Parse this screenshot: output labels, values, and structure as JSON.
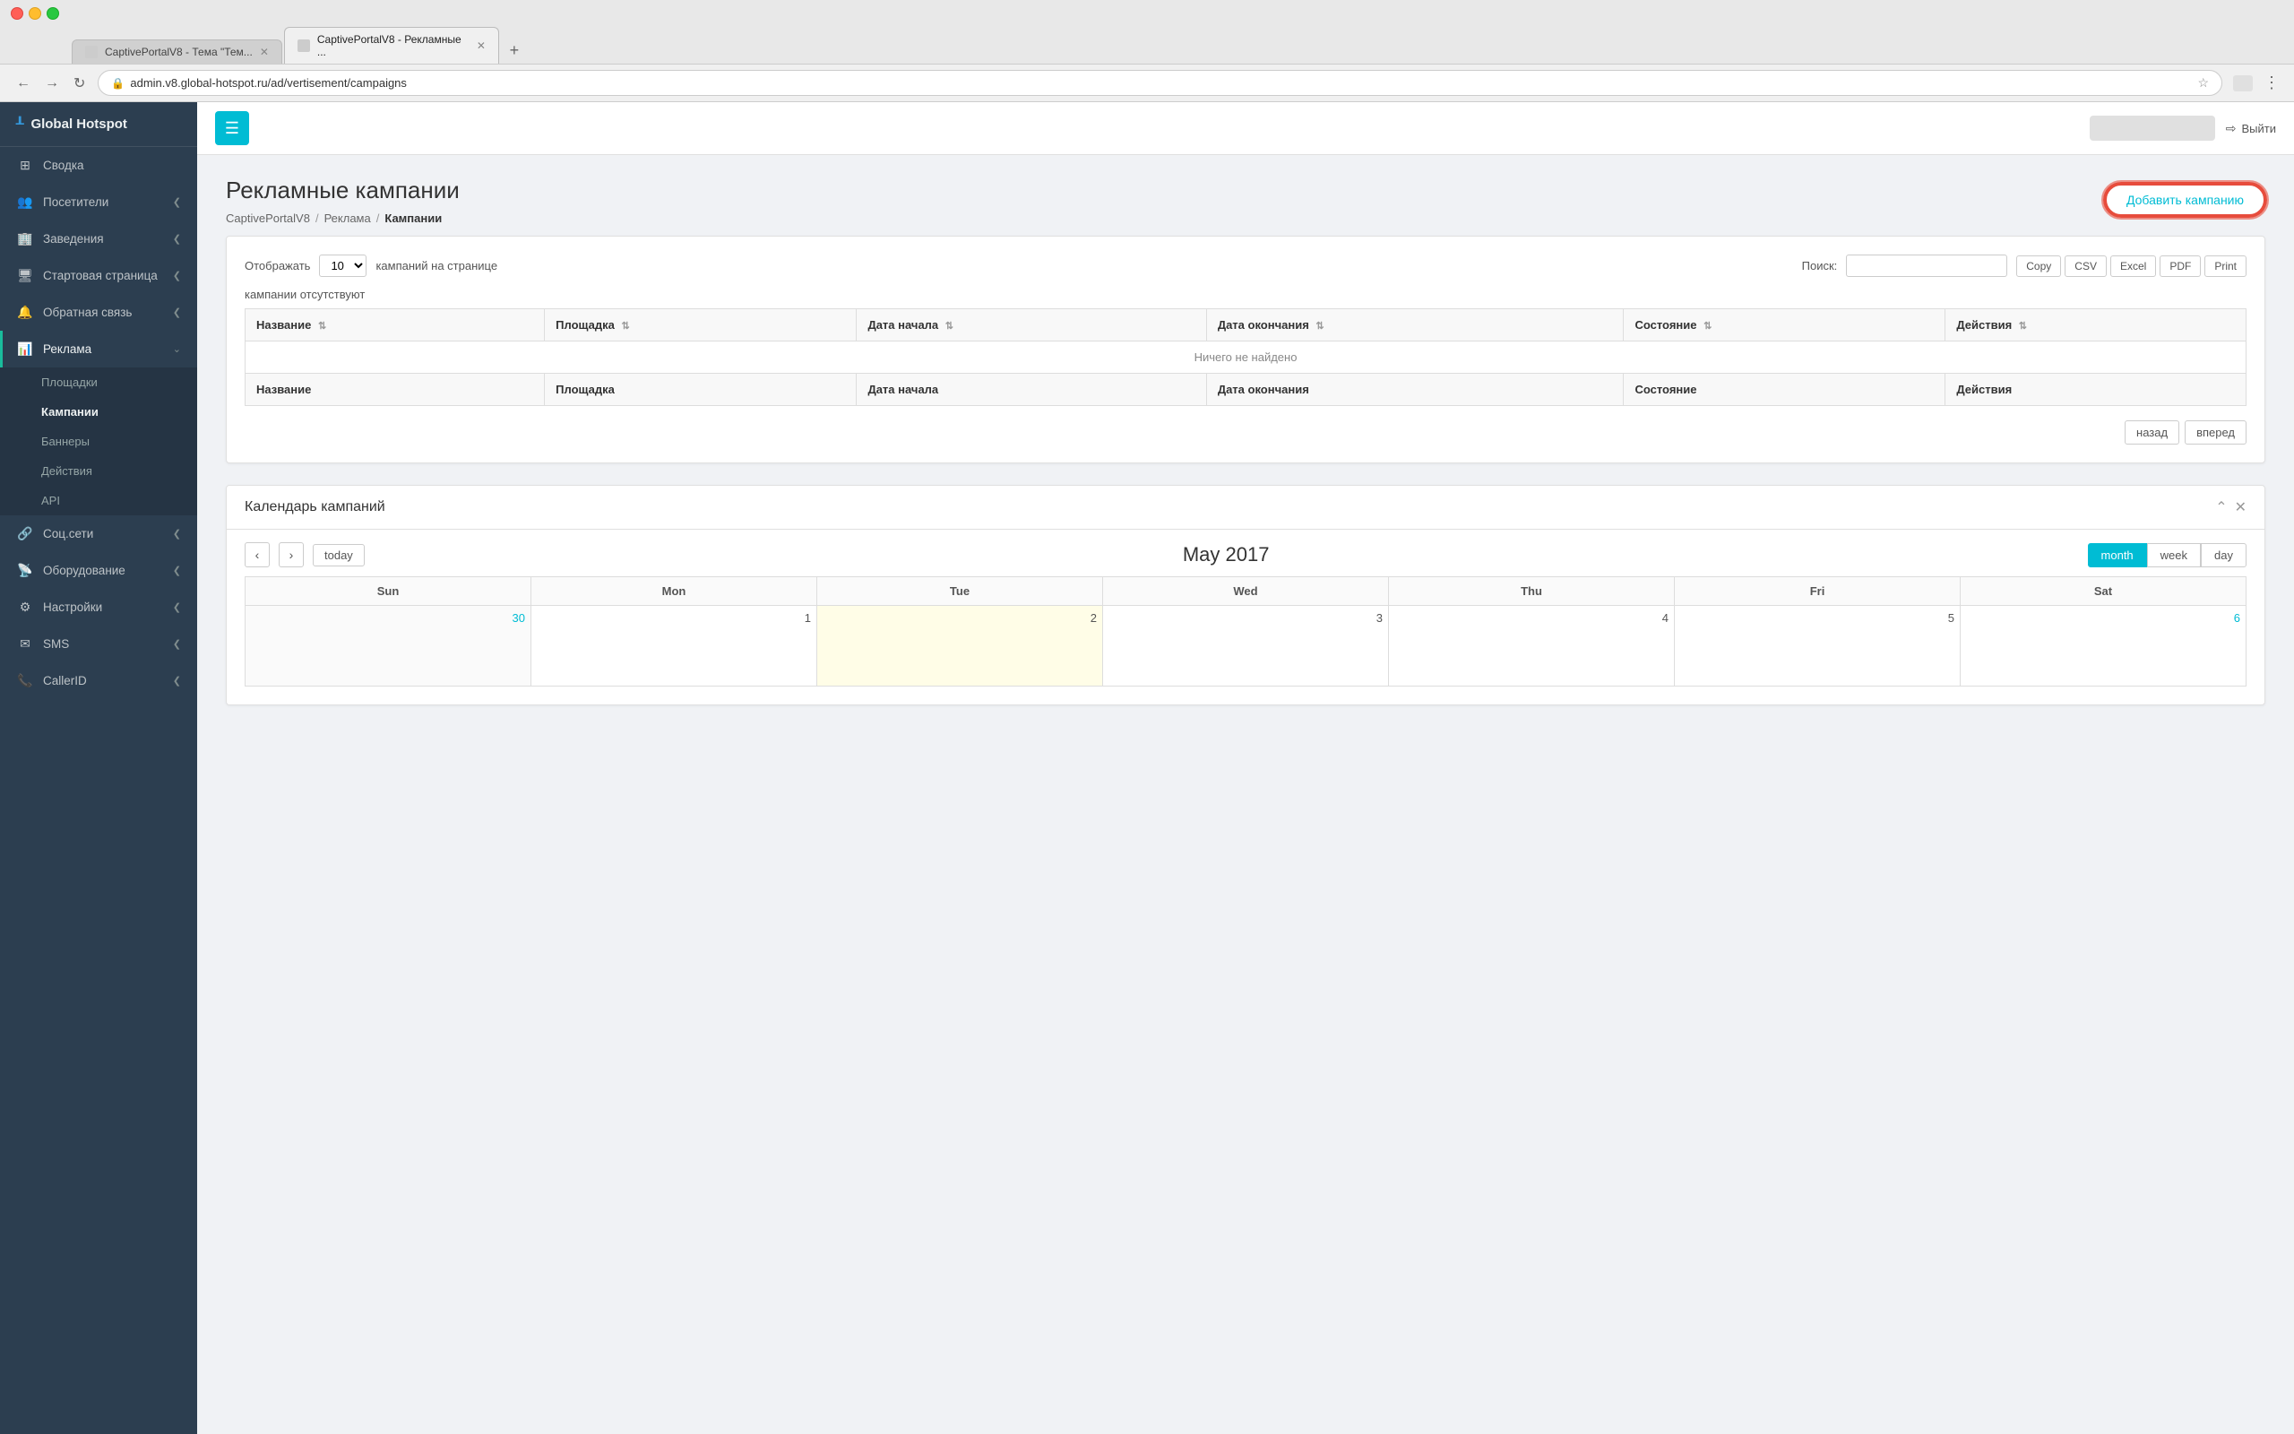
{
  "browser": {
    "tabs": [
      {
        "title": "CaptivePortalV8 - Тема \"Тем...",
        "active": false
      },
      {
        "title": "CaptivePortalV8 - Рекламные ...",
        "active": true
      }
    ],
    "url": "admin.v8.global-hotspot.ru/ad/vertisement/campaigns",
    "url_protocol": "🔒"
  },
  "topbar": {
    "brand": "Global Hotspot",
    "user_placeholder": "████████████████",
    "logout_label": "Выйти"
  },
  "sidebar": {
    "items": [
      {
        "icon": "⊞",
        "label": "Сводка",
        "has_children": false
      },
      {
        "icon": "👥",
        "label": "Посетители",
        "has_children": true
      },
      {
        "icon": "🏢",
        "label": "Заведения",
        "has_children": true
      },
      {
        "icon": "🖥",
        "label": "Стартовая страница",
        "has_children": true
      },
      {
        "icon": "💬",
        "label": "Обратная связь",
        "has_children": true
      },
      {
        "icon": "📊",
        "label": "Реклама",
        "has_children": true,
        "active": true
      }
    ],
    "reklama_sub": [
      {
        "label": "Площадки"
      },
      {
        "label": "Кампании",
        "active": true
      },
      {
        "label": "Баннеры"
      },
      {
        "label": "Действия"
      },
      {
        "label": "API"
      }
    ],
    "items2": [
      {
        "icon": "🔗",
        "label": "Соц.сети",
        "has_children": true
      },
      {
        "icon": "📡",
        "label": "Оборудование",
        "has_children": true
      },
      {
        "icon": "⚙",
        "label": "Настройки",
        "has_children": true
      },
      {
        "icon": "✉",
        "label": "SMS",
        "has_children": true
      },
      {
        "icon": "📞",
        "label": "CallerID",
        "has_children": true
      }
    ]
  },
  "page": {
    "title": "Рекламные кампании",
    "breadcrumb": {
      "root": "CaptivePortalV8",
      "mid": "Реклама",
      "current": "Кампании"
    },
    "add_button": "Добавить кампанию"
  },
  "table_controls": {
    "show_label": "Отображать",
    "page_size": "10",
    "per_page_label": "кампаний на странице",
    "search_label": "Поиск:",
    "search_value": "",
    "export_buttons": [
      "Copy",
      "CSV",
      "Excel",
      "PDF",
      "Print"
    ]
  },
  "campaigns_empty_text": "кампании отсутствуют",
  "table": {
    "columns": [
      "Название",
      "Площадка",
      "Дата начала",
      "Дата окончания",
      "Состояние",
      "Действия"
    ],
    "empty_message": "Ничего не найдено"
  },
  "pagination": {
    "prev": "назад",
    "next": "вперед"
  },
  "calendar": {
    "title": "Календарь кампаний",
    "nav_today": "today",
    "month_title": "May 2017",
    "view_buttons": [
      "month",
      "week",
      "day"
    ],
    "active_view": "month",
    "day_headers": [
      "Sun",
      "Mon",
      "Tue",
      "Wed",
      "Thu",
      "Fri",
      "Sat"
    ],
    "weeks": [
      [
        {
          "date": "30",
          "other": true,
          "today": false
        },
        {
          "date": "1",
          "other": false,
          "today": false
        },
        {
          "date": "2",
          "other": false,
          "today": true
        },
        {
          "date": "3",
          "other": false,
          "today": false
        },
        {
          "date": "4",
          "other": false,
          "today": false
        },
        {
          "date": "5",
          "other": false,
          "today": false
        },
        {
          "date": "6",
          "other": false,
          "today": false
        }
      ]
    ]
  }
}
